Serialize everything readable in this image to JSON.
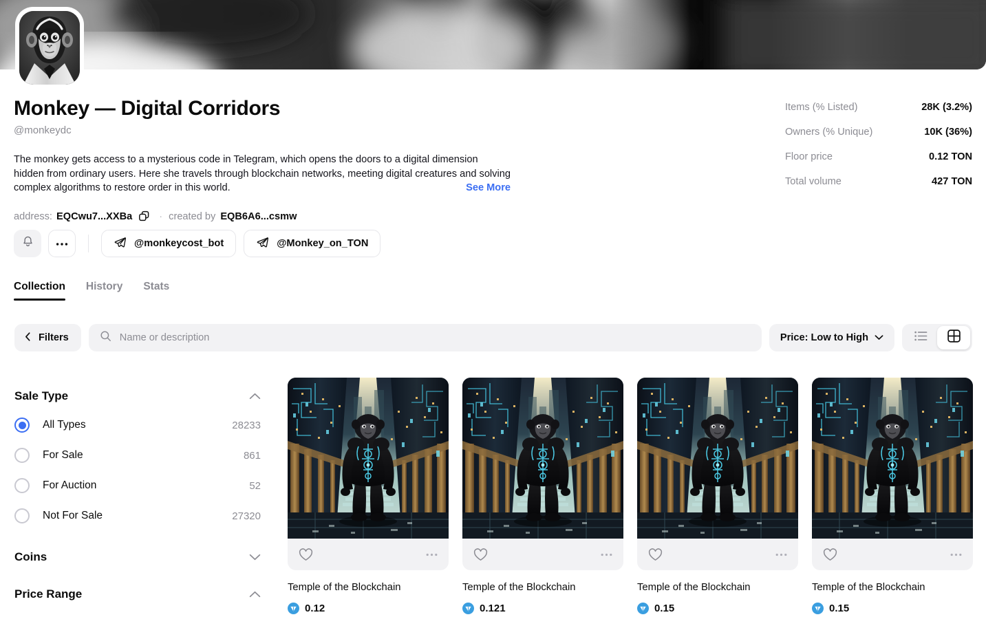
{
  "banner": {
    "alt": "blurred grayscale monkey banner"
  },
  "avatar": {
    "alt": "monkey face avatar"
  },
  "collection": {
    "title": "Monkey — Digital Corridors",
    "handle": "@monkeydc",
    "description": "The monkey gets access to a mysterious code in Telegram, which opens the doors to a digital dimension hidden from ordinary users. Here she travels through blockchain networks, meeting digital creatures and solving complex algorithms to restore order in this world.",
    "see_more": "See More",
    "address_label": "address:",
    "address_value": "EQCwu7...XXBa",
    "separator": "·",
    "created_by_label": "created by",
    "created_by_value": "EQB6A6...csmw"
  },
  "stats": [
    {
      "key": "Items (% Listed)",
      "value": "28K (3.2%)"
    },
    {
      "key": "Owners (% Unique)",
      "value": "10K (36%)"
    },
    {
      "key": "Floor price",
      "value": "0.12 TON"
    },
    {
      "key": "Total volume",
      "value": "427 TON"
    }
  ],
  "actions": {
    "bell_icon": "bell-icon",
    "more_icon": "ellipsis-icon",
    "links": [
      {
        "icon": "telegram-icon",
        "label": "@monkeycost_bot"
      },
      {
        "icon": "telegram-icon",
        "label": "@Monkey_on_TON"
      }
    ]
  },
  "tabs": [
    {
      "label": "Collection",
      "active": true
    },
    {
      "label": "History",
      "active": false
    },
    {
      "label": "Stats",
      "active": false
    }
  ],
  "toolbar": {
    "filters_label": "Filters",
    "search_placeholder": "Name or description",
    "search_value": "",
    "sort_label": "Price: Low to High",
    "view_list": "list-view-icon",
    "view_grid": "grid-view-icon",
    "view_active": "grid"
  },
  "sidebar": {
    "groups": [
      {
        "title": "Sale Type",
        "expanded": true,
        "options": [
          {
            "label": "All Types",
            "count": "28233",
            "selected": true
          },
          {
            "label": "For Sale",
            "count": "861",
            "selected": false
          },
          {
            "label": "For Auction",
            "count": "52",
            "selected": false
          },
          {
            "label": "Not For Sale",
            "count": "27320",
            "selected": false
          }
        ]
      },
      {
        "title": "Coins",
        "expanded": false,
        "options": []
      },
      {
        "title": "Price Range",
        "expanded": true,
        "options": []
      }
    ]
  },
  "items": [
    {
      "name": "Temple of the Blockchain",
      "price": "0.12",
      "currency_icon": "ton-icon"
    },
    {
      "name": "Temple of the Blockchain",
      "price": "0.121",
      "currency_icon": "ton-icon"
    },
    {
      "name": "Temple of the Blockchain",
      "price": "0.15",
      "currency_icon": "ton-icon"
    },
    {
      "name": "Temple of the Blockchain",
      "price": "0.15",
      "currency_icon": "ton-icon"
    }
  ],
  "colors": {
    "accent_blue": "#3b6ef3",
    "text_primary": "#0b0b0b",
    "text_muted": "#8c8c93",
    "surface_grey": "#f2f2f4",
    "border": "#e6e6ea",
    "ton_blue": "#3a9ee0"
  }
}
